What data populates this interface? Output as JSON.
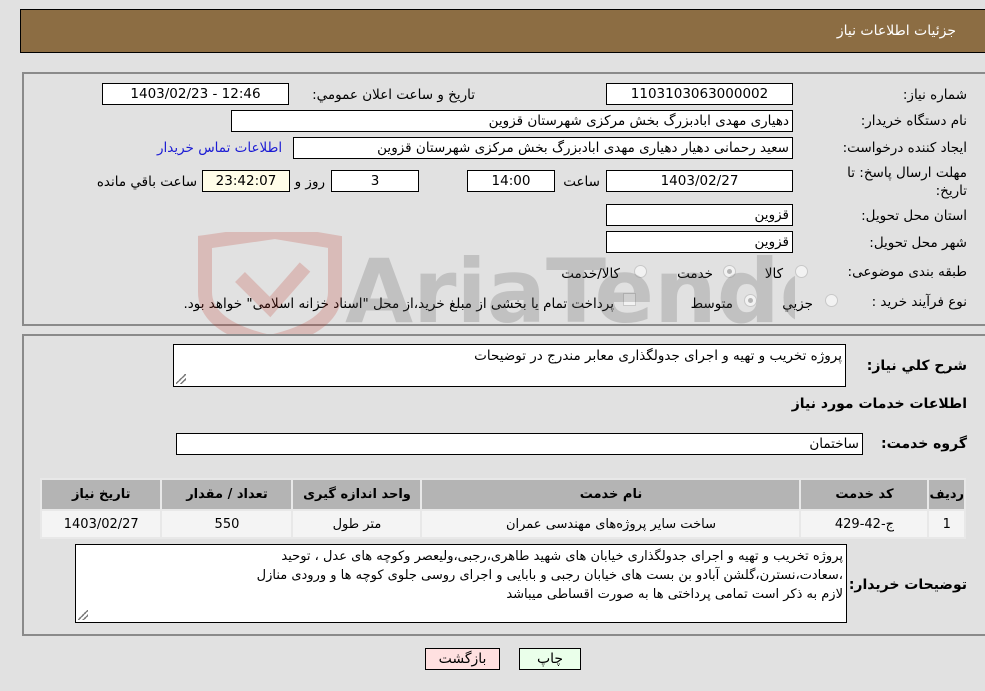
{
  "header": {
    "title": "جزئیات اطلاعات نیاز"
  },
  "form": {
    "need_number": {
      "label": "شماره نیاز:",
      "value": "1103103063000002"
    },
    "announce_datetime": {
      "label": "تاریخ و ساعت اعلان عمومي:",
      "value": "1403/02/23 - 12:46"
    },
    "buyer_org": {
      "label": "نام دستگاه خریدار:",
      "value": "دهیاری مهدی ابادبزرگ بخش مرکزی شهرستان قزوین"
    },
    "requester": {
      "label": "ایجاد کننده درخواست:",
      "value": "سعید رحمانی دهیار دهیاری مهدی ابادبزرگ بخش مرکزی شهرستان قزوین"
    },
    "contact_link": "اطلاعات تماس خریدار",
    "deadline": {
      "label": "مهلت ارسال پاسخ: تا تاریخ:",
      "date": "1403/02/27",
      "time_label": "ساعت",
      "time": "14:00",
      "days": "3",
      "days_label": "روز و",
      "remaining": "23:42:07",
      "remaining_label": "ساعت باقي مانده"
    },
    "province": {
      "label": "استان محل تحویل:",
      "value": "قزوین"
    },
    "city": {
      "label": "شهر محل تحویل:",
      "value": "قزوین"
    },
    "category": {
      "label": "طبقه بندی موضوعی:",
      "options": [
        "کالا",
        "خدمت",
        "کالا/خدمت"
      ],
      "selected": "خدمت"
    },
    "purchase_type": {
      "label": "نوع فرآیند خرید :",
      "options": [
        "جزیي",
        "متوسط"
      ],
      "selected": "متوسط",
      "treasury_note": "پرداخت تمام یا بخشی از مبلغ خرید،از محل \"اسناد خزانه اسلامی\" خواهد بود.",
      "treasury_checked": false
    }
  },
  "summary": {
    "label": "شرح كلي نياز:",
    "value": "پروژه تخریب و تهیه و اجرای جدولگذاری معابر مندرج در توضیحات"
  },
  "services": {
    "section_title": "اطلاعات خدمات مورد نیاز",
    "group_label": "گروه خدمت:",
    "group_value": "ساختمان",
    "columns": [
      "ردیف",
      "کد خدمت",
      "نام خدمت",
      "واحد اندازه گیری",
      "تعداد / مقدار",
      "تاریخ نیاز"
    ],
    "rows": [
      [
        "1",
        "ج-42-429",
        "ساخت سایر پروژه‌های مهندسی عمران",
        "متر طول",
        "550",
        "1403/02/27"
      ]
    ]
  },
  "buyer_notes": {
    "label": "توضیحات خریدار:",
    "lines": [
      "پروژه تخریب و تهیه و اجرای جدولگذاری خیابان های شهید طاهری،رجبی،ولیعصر وکوچه های عدل ، توحید",
      "،سعادت،نسترن،گلشن آبادو بن بست های خیابان رجبی و بابایی و اجرای روسی جلوی کوچه ها و ورودی منازل",
      "لازم به ذکر است تمامی پرداختی ها به صورت اقساطی میباشد"
    ]
  },
  "buttons": {
    "print": "چاپ",
    "back": "بازگشت"
  },
  "watermark": {
    "text": "AriaTender.neT"
  },
  "colors": {
    "header_bg": "#8c6d43",
    "link": "#1b1bd4",
    "print_bg": "#eaffea",
    "back_bg": "#ffe0e0"
  }
}
